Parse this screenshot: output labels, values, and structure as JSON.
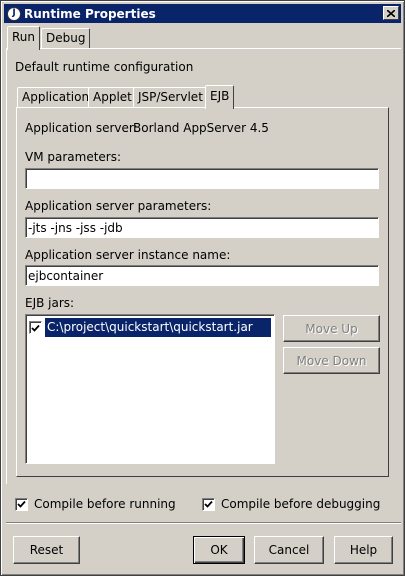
{
  "window": {
    "title": "Runtime Properties",
    "icon": "app-icon",
    "icon_glyph": "J"
  },
  "outer_tabs": [
    {
      "label": "Run",
      "active": true
    },
    {
      "label": "Debug",
      "active": false
    }
  ],
  "section_label": "Default runtime configuration",
  "inner_tabs": [
    {
      "label": "Application",
      "active": false
    },
    {
      "label": "Applet",
      "active": false
    },
    {
      "label": "JSP/Servlet",
      "active": false
    },
    {
      "label": "EJB",
      "active": true
    }
  ],
  "ejb": {
    "app_server_label": "Application server:",
    "app_server_value": "Borland AppServer 4.5",
    "vm_params_label": "VM parameters:",
    "vm_params_value": "",
    "server_params_label": "Application server parameters:",
    "server_params_value": "-jts -jns -jss -jdb",
    "instance_label": "Application server instance name:",
    "instance_value": "ejbcontainer",
    "jars_label": "EJB jars:",
    "jars": [
      {
        "path": "C:\\project\\quickstart\\quickstart.jar",
        "checked": true
      }
    ],
    "move_up": "Move Up",
    "move_down": "Move Down"
  },
  "options": {
    "compile_before_running": "Compile before running",
    "compile_before_debugging": "Compile before debugging"
  },
  "buttons": {
    "reset": "Reset",
    "ok": "OK",
    "cancel": "Cancel",
    "help": "Help"
  },
  "colors": {
    "title_bar": "#0a246a",
    "face": "#d4d0c8",
    "selection": "#0a246a"
  }
}
